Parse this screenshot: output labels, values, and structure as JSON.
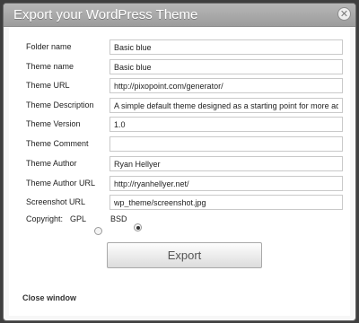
{
  "dialog": {
    "title": "Export your WordPress Theme",
    "close_icon": "close-icon"
  },
  "form": {
    "fields": [
      {
        "label": "Folder name",
        "value": "Basic blue"
      },
      {
        "label": "Theme name",
        "value": "Basic blue"
      },
      {
        "label": "Theme URL",
        "value": "http://pixopoint.com/generator/"
      },
      {
        "label": "Theme Description",
        "value": "A simple default theme designed as a starting point for more advanc"
      },
      {
        "label": "Theme Version",
        "value": "1.0"
      },
      {
        "label": "Theme Comment",
        "value": ""
      },
      {
        "label": "Theme Author",
        "value": "Ryan Hellyer"
      },
      {
        "label": "Theme Author URL",
        "value": "http://ryanhellyer.net/"
      },
      {
        "label": "Screenshot URL",
        "value": "wp_theme/screenshot.jpg"
      }
    ],
    "copyright": {
      "label": "Copyright:",
      "options": [
        "GPL",
        "BSD"
      ],
      "selected": "BSD"
    }
  },
  "actions": {
    "export_label": "Export",
    "close_window_label": "Close window"
  }
}
